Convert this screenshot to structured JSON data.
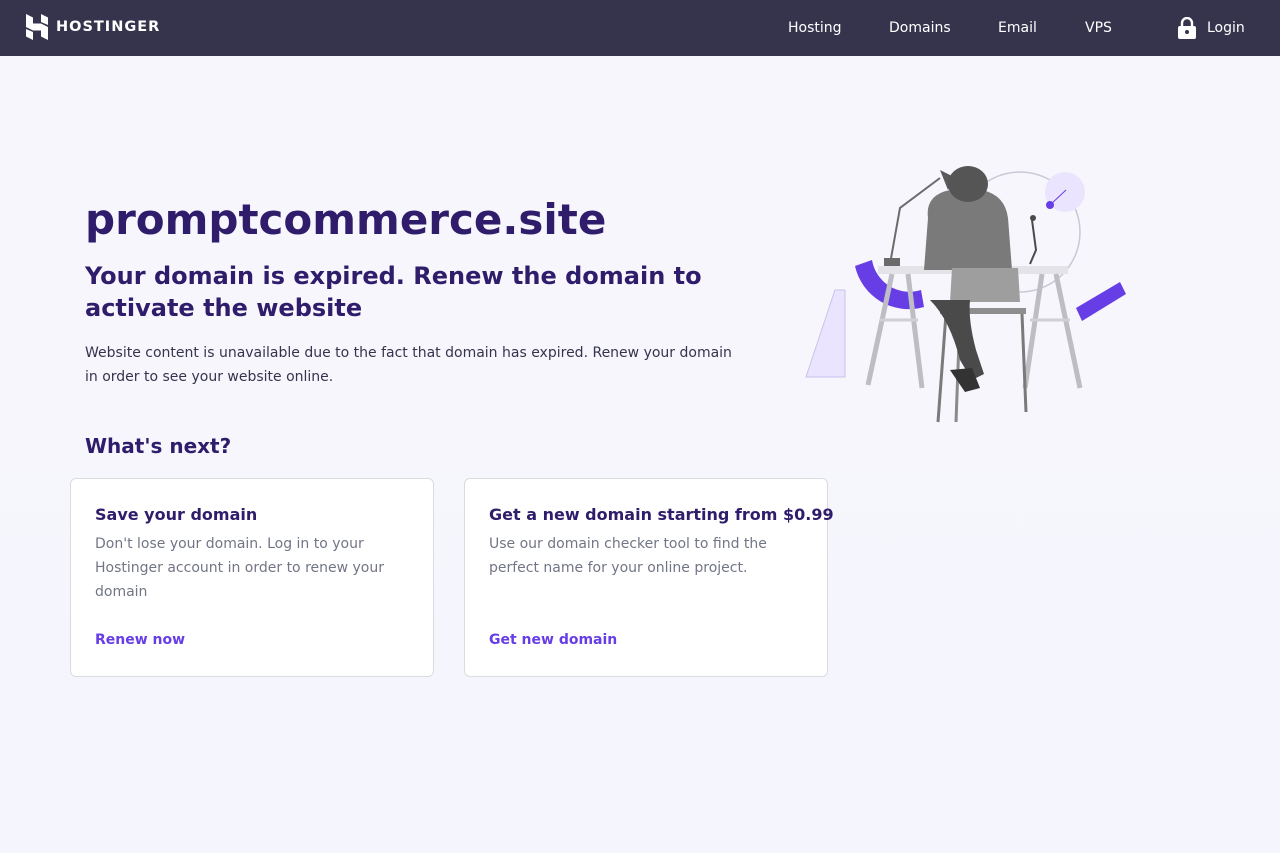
{
  "brand": {
    "name": "HOSTINGER"
  },
  "nav": {
    "links": [
      "Hosting",
      "Domains",
      "Email",
      "VPS"
    ],
    "login_label": "Login"
  },
  "main": {
    "domain": "promptcommerce.site",
    "headline": "Your domain is expired. Renew the domain to activate the website",
    "description": "Website content is unavailable due to the fact that domain has expired. Renew your domain in order to see your website online.",
    "next_title": "What's next?"
  },
  "cards": [
    {
      "title": "Save your domain",
      "text": "Don't lose your domain. Log in to your Hostinger account in order to renew your domain",
      "link": "Renew now"
    },
    {
      "title": "Get a new domain starting from $0.99",
      "text": "Use our domain checker tool to find the perfect name for your online project.",
      "link": "Get new domain"
    }
  ],
  "colors": {
    "navbar": "#36344d",
    "heading": "#2f1c6a",
    "accent": "#673de6",
    "muted_text": "#727586"
  },
  "icons": {
    "logo": "hostinger-logo-icon",
    "login": "lock-icon"
  }
}
